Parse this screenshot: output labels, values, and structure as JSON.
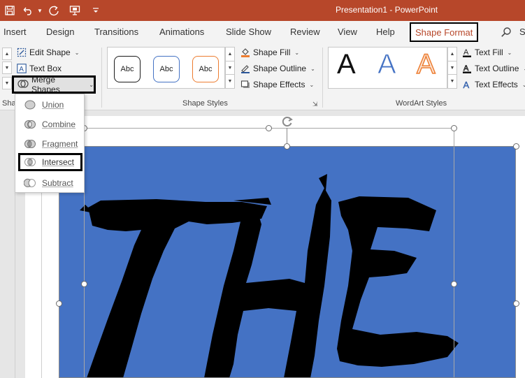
{
  "window": {
    "title": "Presentation1  -  PowerPoint"
  },
  "quick_access": [
    {
      "name": "save-icon"
    },
    {
      "name": "undo-icon"
    },
    {
      "name": "redo-icon"
    },
    {
      "name": "present-icon"
    },
    {
      "name": "customize-qat-icon"
    }
  ],
  "tabs": [
    {
      "name": "tab-insert",
      "label": "Insert"
    },
    {
      "name": "tab-design",
      "label": "Design"
    },
    {
      "name": "tab-transitions",
      "label": "Transitions"
    },
    {
      "name": "tab-animations",
      "label": "Animations"
    },
    {
      "name": "tab-slide-show",
      "label": "Slide Show"
    },
    {
      "name": "tab-review",
      "label": "Review"
    },
    {
      "name": "tab-view",
      "label": "View"
    },
    {
      "name": "tab-help",
      "label": "Help"
    },
    {
      "name": "tab-shape-format",
      "label": "Shape Format"
    }
  ],
  "tab_overflow_label": "S",
  "insert_shapes": {
    "edit_shape": "Edit Shape",
    "text_box": "Text Box",
    "merge_shapes": "Merge Shapes",
    "group_label_partial": "Sha"
  },
  "shape_styles": {
    "swatch_text": "Abc",
    "swatches": [
      {
        "border": "#1a1a1a"
      },
      {
        "border": "#4472c4"
      },
      {
        "border": "#ed7d31"
      }
    ],
    "shape_fill": "Shape Fill",
    "shape_outline": "Shape Outline",
    "shape_effects": "Shape Effects",
    "group_label": "Shape Styles"
  },
  "wordart_styles": {
    "letter": "A",
    "samples": [
      {
        "fill": "#111111",
        "stroke": "none"
      },
      {
        "fill": "#4472c4",
        "stroke": "#ffffff"
      },
      {
        "fill": "#fbe5d6",
        "stroke": "#ed7d31"
      }
    ],
    "text_fill": "Text Fill",
    "text_outline": "Text Outline",
    "text_effects": "Text Effects",
    "group_label": "WordArt Styles"
  },
  "merge_menu": {
    "items": [
      {
        "name": "menu-item-union",
        "label": "Union",
        "active": false
      },
      {
        "name": "menu-item-combine",
        "label": "Combine",
        "active": false
      },
      {
        "name": "menu-item-fragment",
        "label": "Fragment",
        "active": false
      },
      {
        "name": "menu-item-intersect",
        "label": "Intersect",
        "active": true
      },
      {
        "name": "menu-item-subtract",
        "label": "Subtract",
        "active": false
      }
    ]
  },
  "slide": {
    "image_background": "#4472c4",
    "image_text": "THE"
  },
  "colors": {
    "accent": "#b7472a",
    "ribbon_bg": "#f3f3f3"
  }
}
